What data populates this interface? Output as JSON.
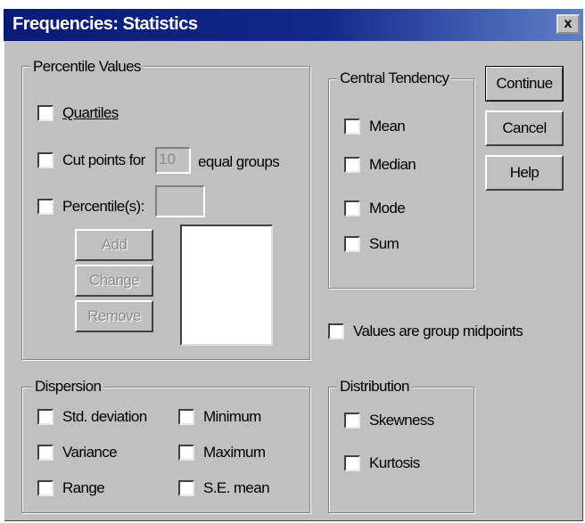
{
  "window": {
    "title": "Frequencies: Statistics",
    "close_glyph": "x"
  },
  "percentile_values": {
    "label": "Percentile Values",
    "quartiles": "Quartiles",
    "cut_points_label": "Cut points for",
    "cut_points_value": "10",
    "equal_groups": "equal groups",
    "percentiles_label": "Percentile(s):",
    "percentiles_value": "",
    "add": "Add",
    "change": "Change",
    "remove": "Remove"
  },
  "central_tendency": {
    "label": "Central Tendency",
    "mean": "Mean",
    "median": "Median",
    "mode": "Mode",
    "sum": "Sum"
  },
  "buttons": {
    "continue": "Continue",
    "cancel": "Cancel",
    "help": "Help"
  },
  "group_midpoints": "Values are group midpoints",
  "dispersion": {
    "label": "Dispersion",
    "std_deviation": "Std. deviation",
    "variance": "Variance",
    "range": "Range",
    "minimum": "Minimum",
    "maximum": "Maximum",
    "se_mean": "S.E. mean"
  },
  "distribution": {
    "label": "Distribution",
    "skewness": "Skewness",
    "kurtosis": "Kurtosis"
  }
}
